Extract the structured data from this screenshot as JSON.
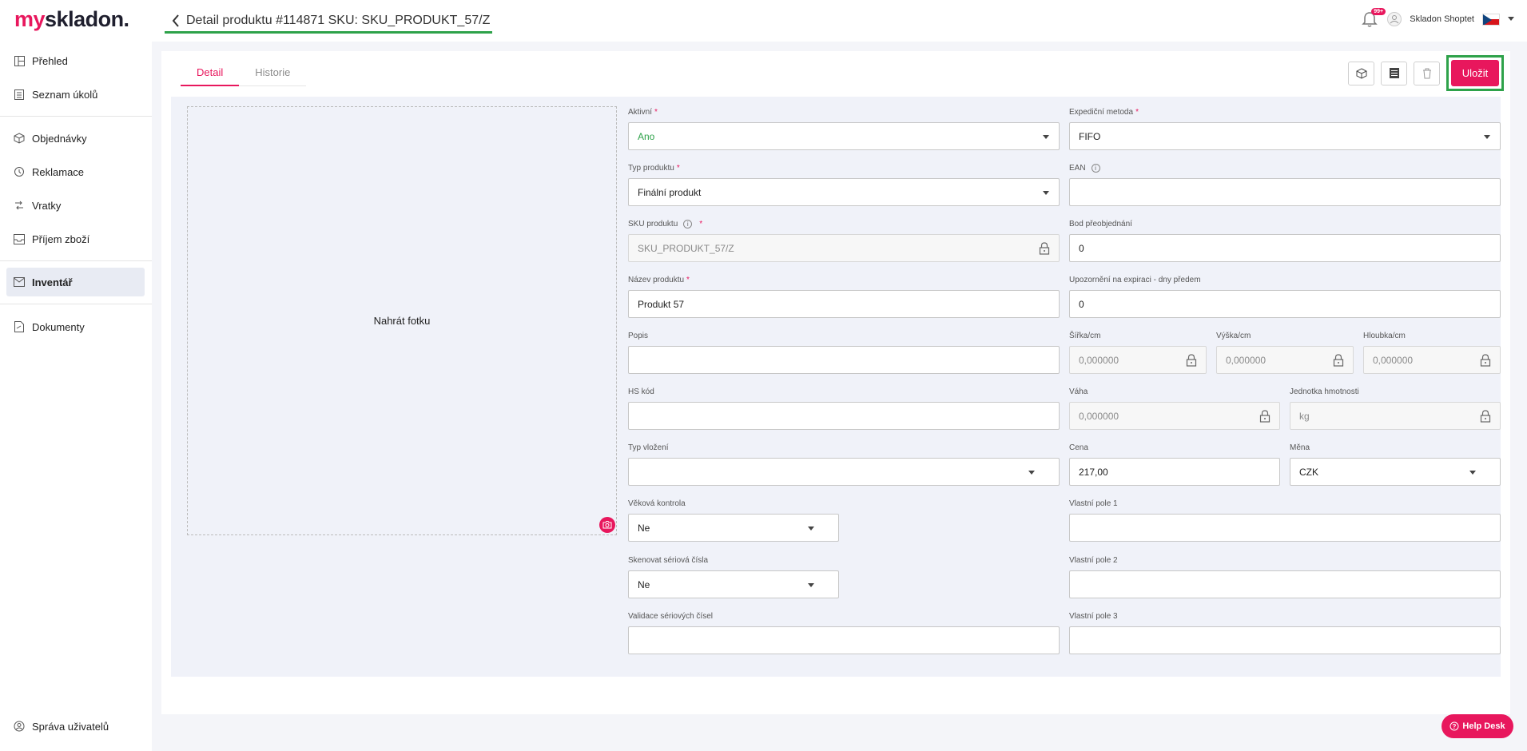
{
  "header": {
    "logo_prefix": "my",
    "logo_rest": "skladon.",
    "title": "Detail produktu #114871 SKU: SKU_PRODUKT_57/Z",
    "notification_badge": "99+",
    "user_name": "Skladon Shoptet"
  },
  "sidebar": {
    "items": [
      {
        "label": "Přehled",
        "icon": "dashboard-icon"
      },
      {
        "label": "Seznam úkolů",
        "icon": "clipboard-icon"
      },
      {
        "label": "Objednávky",
        "icon": "box-icon"
      },
      {
        "label": "Reklamace",
        "icon": "return-icon"
      },
      {
        "label": "Vratky",
        "icon": "arrows-icon"
      },
      {
        "label": "Příjem zboží",
        "icon": "inbox-icon"
      },
      {
        "label": "Inventář",
        "icon": "inventory-icon"
      },
      {
        "label": "Dokumenty",
        "icon": "document-icon"
      }
    ],
    "footer": "Správa uživatelů"
  },
  "tabs": [
    "Detail",
    "Historie"
  ],
  "actions": {
    "save_label": "Uložit"
  },
  "photo": {
    "label": "Nahrát fotku"
  },
  "form": {
    "aktivni": {
      "label": "Aktivní",
      "value": "Ano"
    },
    "expedicni": {
      "label": "Expediční metoda",
      "value": "FIFO"
    },
    "typ_produktu": {
      "label": "Typ produktu",
      "value": "Finální produkt"
    },
    "ean": {
      "label": "EAN",
      "value": ""
    },
    "sku": {
      "label": "SKU produktu",
      "value": "SKU_PRODUKT_57/Z"
    },
    "bod": {
      "label": "Bod přeobjednání",
      "value": "0"
    },
    "nazev": {
      "label": "Název produktu",
      "value": "Produkt 57"
    },
    "upozorneni": {
      "label": "Upozornění na expiraci - dny předem",
      "value": "0"
    },
    "popis": {
      "label": "Popis",
      "value": ""
    },
    "sirka": {
      "label": "Šířka/cm",
      "value": "0,000000"
    },
    "vyska": {
      "label": "Výška/cm",
      "value": "0,000000"
    },
    "hloubka": {
      "label": "Hloubka/cm",
      "value": "0,000000"
    },
    "hs": {
      "label": "HS kód",
      "value": ""
    },
    "vaha": {
      "label": "Váha",
      "value": "0,000000"
    },
    "jednotka": {
      "label": "Jednotka hmotnosti",
      "value": "kg"
    },
    "typ_vlozeni": {
      "label": "Typ vložení",
      "value": ""
    },
    "cena": {
      "label": "Cena",
      "value": "217,00"
    },
    "mena": {
      "label": "Měna",
      "value": "CZK"
    },
    "vekova": {
      "label": "Věková kontrola",
      "value": "Ne"
    },
    "vlastni1": {
      "label": "Vlastní pole 1",
      "value": ""
    },
    "skenovat": {
      "label": "Skenovat sériová čísla",
      "value": "Ne"
    },
    "vlastni2": {
      "label": "Vlastní pole 2",
      "value": ""
    },
    "validace": {
      "label": "Validace sériových čísel",
      "value": ""
    },
    "vlastni3": {
      "label": "Vlastní pole 3",
      "value": ""
    }
  },
  "help": {
    "label": "Help Desk"
  }
}
